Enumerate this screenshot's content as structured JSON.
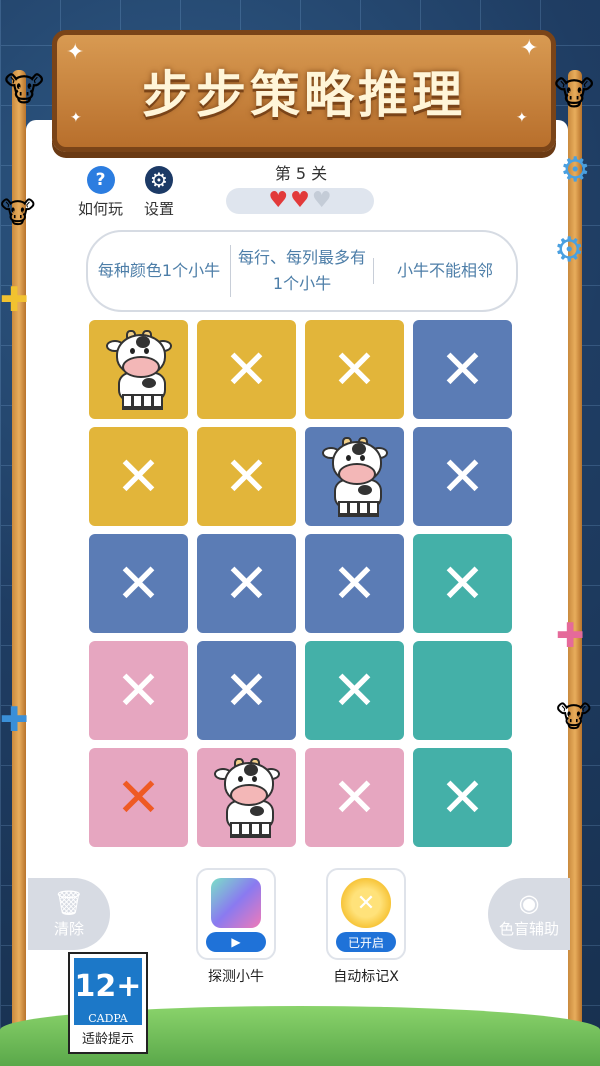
{
  "title": "步步策略推理",
  "header": {
    "help_label": "如何玩",
    "help_icon": "question-icon",
    "settings_label": "设置",
    "settings_icon": "gear-icon",
    "level": "第 5 关",
    "lives_remaining": 2,
    "lives_total": 3
  },
  "rules": [
    "每种颜色1个小牛",
    "每行、每列最多有1个小牛",
    "小牛不能相邻"
  ],
  "colors": {
    "yellow": "#e2b53a",
    "blue": "#5b7cb5",
    "teal": "#44b0a8",
    "pink": "#e6a6c0",
    "error_x": "#ef5a24"
  },
  "grid": {
    "rows": [
      [
        {
          "color": "yellow",
          "mark": "cow"
        },
        {
          "color": "yellow",
          "mark": "x"
        },
        {
          "color": "yellow",
          "mark": "x"
        },
        {
          "color": "blue",
          "mark": "x"
        }
      ],
      [
        {
          "color": "yellow",
          "mark": "x"
        },
        {
          "color": "yellow",
          "mark": "x"
        },
        {
          "color": "blue",
          "mark": "cow"
        },
        {
          "color": "blue",
          "mark": "x"
        }
      ],
      [
        {
          "color": "blue",
          "mark": "x"
        },
        {
          "color": "blue",
          "mark": "x"
        },
        {
          "color": "blue",
          "mark": "x"
        },
        {
          "color": "teal",
          "mark": "x"
        }
      ],
      [
        {
          "color": "pink",
          "mark": "x"
        },
        {
          "color": "blue",
          "mark": "x"
        },
        {
          "color": "teal",
          "mark": "x"
        },
        {
          "color": "teal",
          "mark": "empty"
        }
      ],
      [
        {
          "color": "pink",
          "mark": "x-error"
        },
        {
          "color": "pink",
          "mark": "cow"
        },
        {
          "color": "pink",
          "mark": "x"
        },
        {
          "color": "teal",
          "mark": "x"
        }
      ]
    ]
  },
  "bottom": {
    "clear_label": "清除",
    "clear_icon": "trash-icon",
    "colorblind_label": "色盲辅助",
    "colorblind_icon": "eye-icon",
    "detect_label": "探测小牛",
    "detect_icon": "video-icon",
    "automark_label": "自动标记X",
    "automark_status": "已开启",
    "automark_icon": "lightbulb-icon"
  },
  "age_rating": {
    "rating": "12+",
    "org": "CADPA",
    "tip": "适龄提示"
  }
}
